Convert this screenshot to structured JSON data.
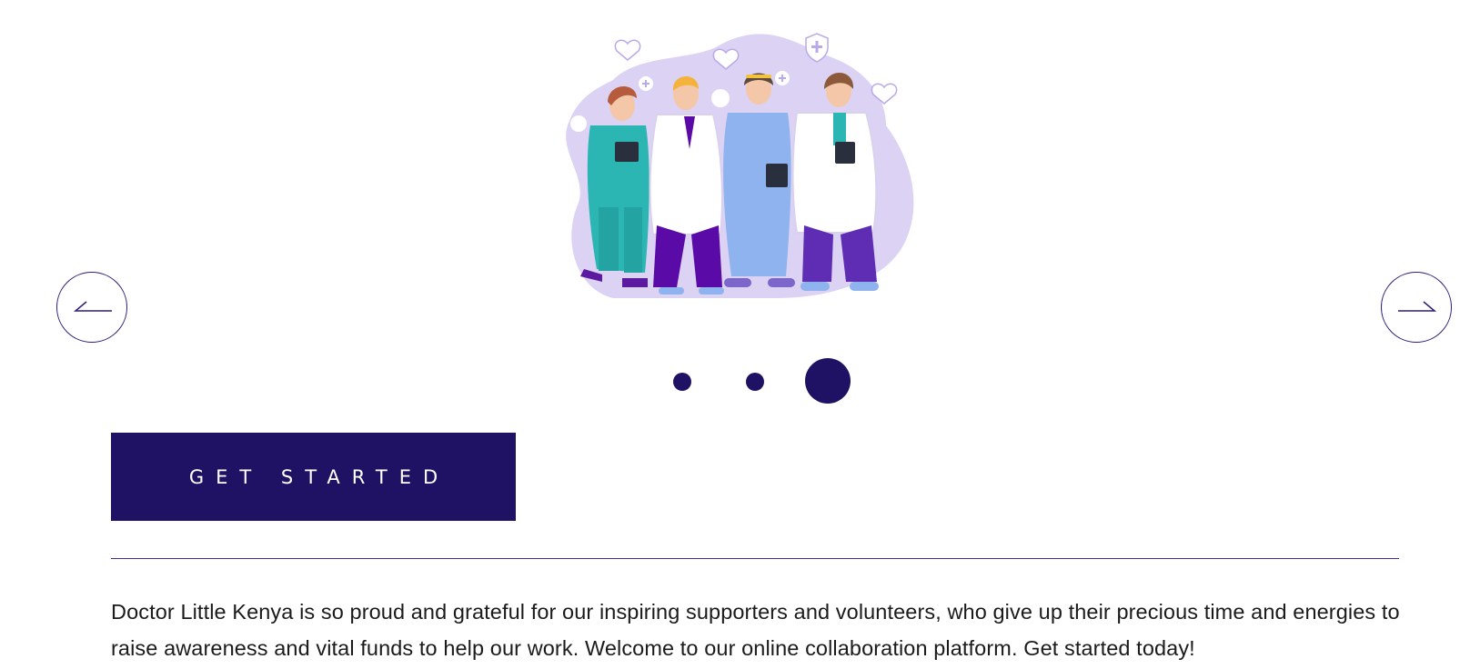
{
  "hero": {
    "illustration_description": "illustration-medical-team",
    "illustration_icon": "medical-team-illustration"
  },
  "carousel": {
    "prev_icon": "arrow-left-icon",
    "next_icon": "arrow-right-icon",
    "slide_count": 3,
    "active_slide": 3
  },
  "cta": {
    "label": "GET STARTED"
  },
  "intro": {
    "text": "Doctor Little Kenya is so proud and grateful for our inspiring supporters and volunteers, who give up their precious time and energies to raise awareness and vital funds to help our work. Welcome to our online collaboration platform. Get started today!"
  },
  "colors": {
    "brand_navy": "#1f1264",
    "lavender": "#d9cff2",
    "teal": "#2bb5b3",
    "blue": "#8fb3ef",
    "purple": "#5a21a8"
  }
}
